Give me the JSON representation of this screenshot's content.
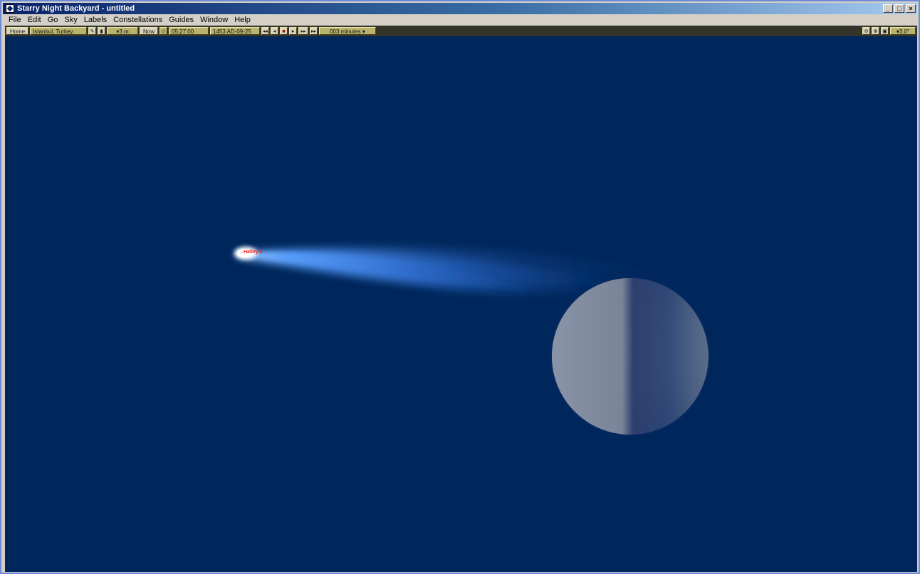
{
  "window": {
    "title": "Starry Night Backyard - untitled",
    "controls": [
      "_",
      "□",
      "×"
    ]
  },
  "menu": [
    "File",
    "Edit",
    "Go",
    "Sky",
    "Labels",
    "Constellations",
    "Guides",
    "Window",
    "Help"
  ],
  "toolbar": {
    "home_label": "Home",
    "location": "Istanbul, Turkey",
    "elevation": "▾3 m",
    "now_label": "Now",
    "time": "05:27:00",
    "date": "1453 AD-09-25",
    "time_step": "003 minutes",
    "zoom": "▾3.0°"
  },
  "sky": {
    "background_color": "#00275c",
    "comet": {
      "label": "Halley's",
      "label_color": "#ff1a1a"
    },
    "moon": {
      "phase": "half-illuminated"
    }
  }
}
